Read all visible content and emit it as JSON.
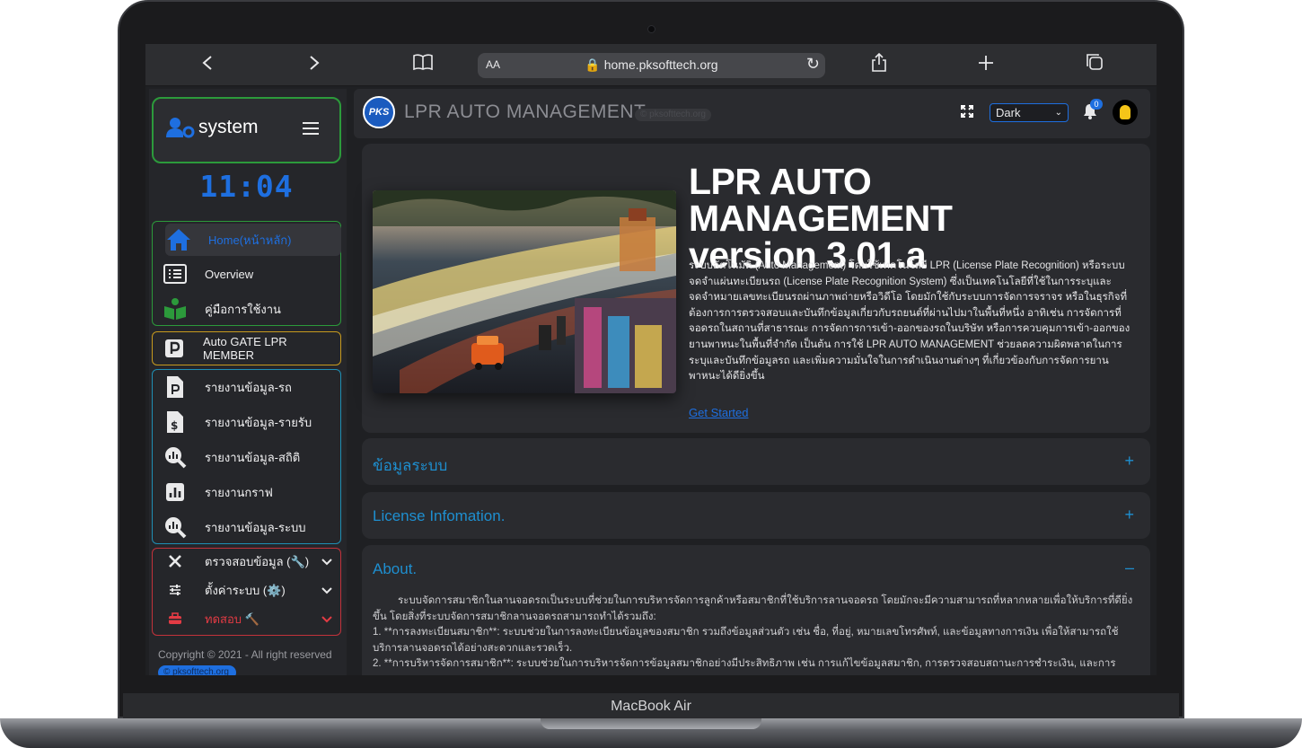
{
  "device": {
    "label": "MacBook Air"
  },
  "browser": {
    "url": "home.pksofttech.org",
    "reader_label": "AA",
    "icons": [
      "back-icon",
      "forward-icon",
      "bookmarks-icon",
      "lock-icon",
      "reload-icon",
      "share-icon",
      "new-tab-icon",
      "tabs-icon"
    ]
  },
  "sidebar": {
    "logo_text": "system",
    "clock": "11:04",
    "items_green": [
      {
        "label": "Home(หน้าหลัก)",
        "icon": "home-icon"
      },
      {
        "label": "Overview",
        "icon": "list-icon"
      },
      {
        "label": "คู่มือการใช้งาน",
        "icon": "manual-icon"
      }
    ],
    "items_yellow": [
      {
        "label": "Auto GATE LPR MEMBER",
        "icon": "parking-icon"
      }
    ],
    "items_cyan": [
      {
        "label": "รายงานข้อมูล-รถ",
        "icon": "parking-file-icon"
      },
      {
        "label": "รายงานข้อมูล-รายรับ",
        "icon": "invoice-icon"
      },
      {
        "label": "รายงานข้อมูล-สถิติ",
        "icon": "search-chart-icon"
      },
      {
        "label": "รายงานกราฟ",
        "icon": "bar-chart-icon"
      },
      {
        "label": "รายงานข้อมูล-ระบบ",
        "icon": "search-chart-icon"
      }
    ],
    "items_red": [
      {
        "label": "ตรวจสอบข้อมูล (🔧)",
        "icon": "tools-icon"
      },
      {
        "label": "ตั้งค่าระบบ (⚙️)",
        "icon": "sliders-icon"
      },
      {
        "label": "ทดสอบ 🔨",
        "icon": "toolbox-icon"
      }
    ],
    "copyright": "Copyright © 2021 - All right reserved",
    "copyright_badge": "pksofttech.org"
  },
  "topbar": {
    "logo": "PKS",
    "title": "LPR AUTO MANAGEMENT",
    "subtitle": "pksofttech.org",
    "theme_selected": "Dark",
    "notification_count": "0"
  },
  "hero": {
    "title_line1": "LPR AUTO MANAGEMENT",
    "title_line2": "version 3.01.a",
    "description": "ระบบอัตโนมัติ (Auto Management) โดยใช้เทคโนโลยี LPR (License Plate Recognition) หรือระบบจดจำแผ่นทะเบียนรถ (License Plate Recognition System) ซึ่งเป็นเทคโนโลยีที่ใช้ในการระบุและจดจำหมายเลขทะเบียนรถผ่านภาพถ่ายหรือวิดีโอ โดยมักใช้กับระบบการจัดการจราจร หรือในธุรกิจที่ต้องการการตรวจสอบและบันทึกข้อมูลเกี่ยวกับรถยนต์ที่ผ่านไปมาในพื้นที่หนึ่ง อาทิเช่น การจัดการที่จอดรถในสถานที่สาธารณะ การจัดการการเข้า-ออกของรถในบริษัท หรือการควบคุมการเข้า-ออกของยานพาหนะในพื้นที่จำกัด เป็นต้น การใช้ LPR AUTO MANAGEMENT ช่วยลดความผิดพลาดในการระบุและบันทึกข้อมูลรถ และเพิ่มความมั่นใจในการดำเนินงานต่างๆ ที่เกี่ยวข้องกับการจัดการยานพาหนะได้ดียิ่งขึ้น",
    "link": "Get Started"
  },
  "accordions": [
    {
      "title": "ข้อมูลระบบ",
      "sign": "+"
    },
    {
      "title": "License Infomation.",
      "sign": "+"
    },
    {
      "title": "About.",
      "sign": "–"
    }
  ],
  "about": {
    "p1": "ระบบจัดการสมาชิกในลานจอดรถเป็นระบบที่ช่วยในการบริหารจัดการลูกค้าหรือสมาชิกที่ใช้บริการลานจอดรถ โดยมักจะมีความสามารถที่หลากหลายเพื่อให้บริการที่ดียิ่งขึ้น โดยสิ่งที่ระบบจัดการสมาชิกลานจอดรถสามารถทำได้รวมถึง:",
    "p2": "1. **การลงทะเบียนสมาชิก**: ระบบช่วยในการลงทะเบียนข้อมูลของสมาชิก รวมถึงข้อมูลส่วนตัว เช่น ชื่อ, ที่อยู่, หมายเลขโทรศัพท์, และข้อมูลทางการเงิน เพื่อให้สามารถใช้บริการลานจอดรถได้อย่างสะดวกและรวดเร็ว.",
    "p3": "2. **การบริหารจัดการสมาชิก**: ระบบช่วยในการบริหารจัดการข้อมูลสมาชิกอย่างมีประสิทธิภาพ เช่น การแก้ไขข้อมูลสมาชิก, การตรวจสอบสถานะการชำระเงิน, และการ"
  },
  "colors": {
    "accent": "#1e6fe0",
    "green": "#2c9a3b",
    "yellow": "#c79a1e",
    "cyan": "#1f8fb4",
    "red": "#c2323b"
  }
}
